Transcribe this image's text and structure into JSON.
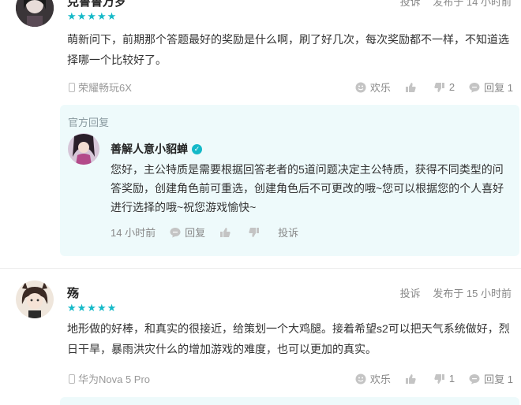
{
  "reviews": [
    {
      "username": "克鲁鲁万岁",
      "stars": "★★★★★",
      "report": "投诉",
      "time": "发布于 14 小时前",
      "text": "萌新问下，前期那个答题最好的奖励是什么啊，刷了好几次，每次奖励都不一样，不知道选择哪一个比较好了。",
      "device": "荣耀畅玩6X",
      "fun_label": "欢乐",
      "dislike_count": "2",
      "reply_label": "回复 1",
      "official_reply": {
        "title": "官方回复",
        "name": "善解人意小貂蝉",
        "verified": "✓",
        "text": "您好，主公特质是需要根据回答老者的5道问题决定主公特质，获得不同类型的问答奖励，创建角色前可重选，创建角色后不可更改的哦~您可以根据您的个人喜好进行选择的哦~祝您游戏愉快~",
        "time": "14 小时前",
        "reply_label": "回复",
        "report": "投诉"
      }
    },
    {
      "username": "殇",
      "stars": "★★★★★",
      "report": "投诉",
      "time": "发布于 15 小时前",
      "text": "地形做的好棒，和真实的很接近，给策划一个大鸡腿。接着希望s2可以把天气系统做好，烈日干旱，暴雨洪灾什么的增加游戏的难度，也可以更加的真实。",
      "device": "华为Nova 5 Pro",
      "fun_label": "欢乐",
      "dislike_count": "1",
      "reply_label": "回复 1"
    }
  ],
  "colors": {
    "accent": "#14b9c8",
    "reply_bg": "#eefafb"
  }
}
